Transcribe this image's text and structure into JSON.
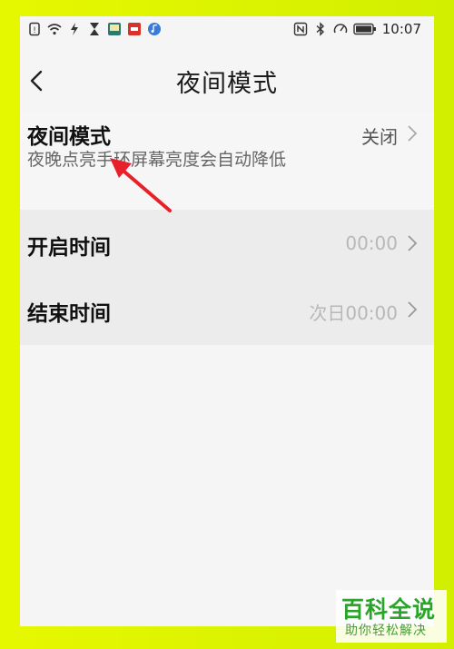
{
  "status_bar": {
    "time": "10:07",
    "left_icons": [
      "sim-icon",
      "wifi-icon",
      "flash-icon",
      "hourglass-icon",
      "app-icon",
      "app-red-icon",
      "music-icon"
    ],
    "right_icons": [
      "nfc-icon",
      "bluetooth-icon",
      "speed-icon",
      "battery-icon"
    ]
  },
  "nav": {
    "title": "夜间模式"
  },
  "settings": {
    "night_mode": {
      "title": "夜间模式",
      "description": "夜晚点亮手环屏幕亮度会自动降低",
      "value": "关闭"
    },
    "start_time": {
      "title": "开启时间",
      "value": "00:00"
    },
    "end_time": {
      "title": "结束时间",
      "value": "次日00:00"
    }
  },
  "watermark": {
    "title": "百科全说",
    "subtitle": "助你轻松解决"
  },
  "colors": {
    "frame": "#d8f000",
    "screen_bg": "#f5f5f5",
    "arrow": "#e8202a",
    "watermark": "#2aa52a"
  }
}
